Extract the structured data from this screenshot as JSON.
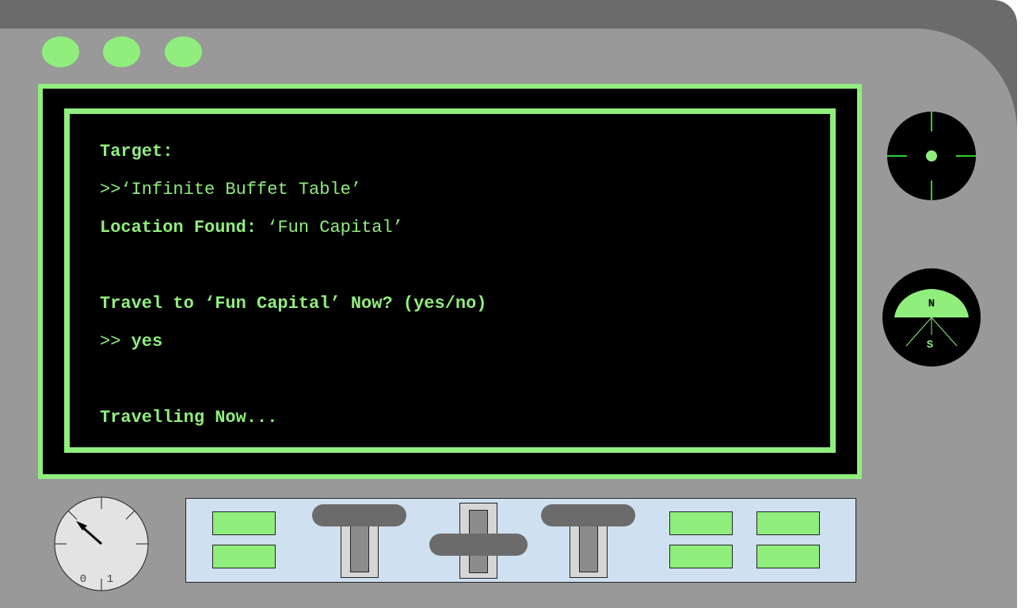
{
  "terminal": {
    "target_label": "Target:",
    "target_prompt": ">>",
    "target_value": "‘Infinite Buffet Table’",
    "location_label": "Location Found:",
    "location_value": " ‘Fun Capital’",
    "question": "Travel to ‘Fun Capital’ Now? (yes/no)",
    "answer_prompt": ">> ",
    "answer": "yes",
    "status": "Travelling Now..."
  },
  "compass": {
    "north_label": "N",
    "south_label": "S"
  },
  "dial": {
    "label_zero": "0",
    "label_one": "1"
  },
  "indicator_lights": [
    "power-led",
    "status-led",
    "signal-led"
  ],
  "icons": {
    "crosshair": "crosshair-icon",
    "compass": "compass-icon",
    "dial": "gauge-dial-icon"
  },
  "colors": {
    "accent_green": "#90ee7d",
    "console_gray": "#999999",
    "console_dark": "#6b6b6b",
    "panel_blue": "#cfe0f0",
    "screen_black": "#000000"
  }
}
